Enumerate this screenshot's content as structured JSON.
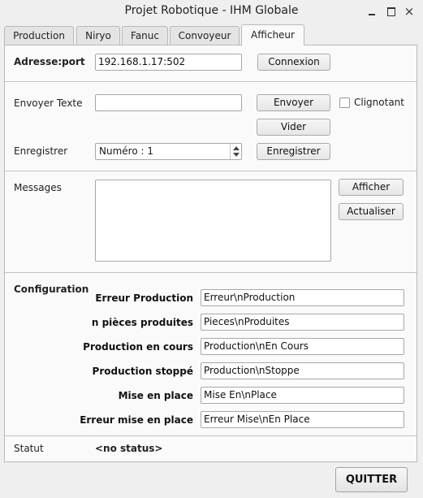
{
  "window": {
    "title": "Projet Robotique - IHM Globale",
    "minimize_glyph": "",
    "close_glyph": "×"
  },
  "tabs": [
    {
      "label": "Production"
    },
    {
      "label": "Niryo"
    },
    {
      "label": "Fanuc"
    },
    {
      "label": "Convoyeur"
    },
    {
      "label": "Afficheur",
      "active": true
    }
  ],
  "connection": {
    "address_label": "Adresse:port",
    "address_value": "192.168.1.17:502",
    "connect_button": "Connexion"
  },
  "send": {
    "label": "Envoyer Texte",
    "text_value": "",
    "send_button": "Envoyer",
    "blink_label": "Clignotant",
    "blink_checked": false,
    "clear_button": "Vider"
  },
  "record": {
    "label": "Enregistrer",
    "number_value": "Numéro : 1",
    "record_button": "Enregistrer"
  },
  "messages": {
    "label": "Messages",
    "content": "",
    "show_button": "Afficher",
    "refresh_button": "Actualiser"
  },
  "configuration": {
    "title": "Configuration",
    "rows": [
      {
        "label": "Erreur Production",
        "value": "Erreur\\nProduction"
      },
      {
        "label": "n pièces produites",
        "value": " Pieces\\nProduites"
      },
      {
        "label": "Production en cours",
        "value": "Production\\nEn Cours"
      },
      {
        "label": "Production stoppé",
        "value": "Production\\nStoppe"
      },
      {
        "label": "Mise en place",
        "value": "Mise En\\nPlace"
      },
      {
        "label": "Erreur mise en place",
        "value": "Erreur Mise\\nEn Place"
      }
    ]
  },
  "status": {
    "label": "Statut",
    "value": "<no status>"
  },
  "footer": {
    "quit_button": "QUITTER"
  }
}
